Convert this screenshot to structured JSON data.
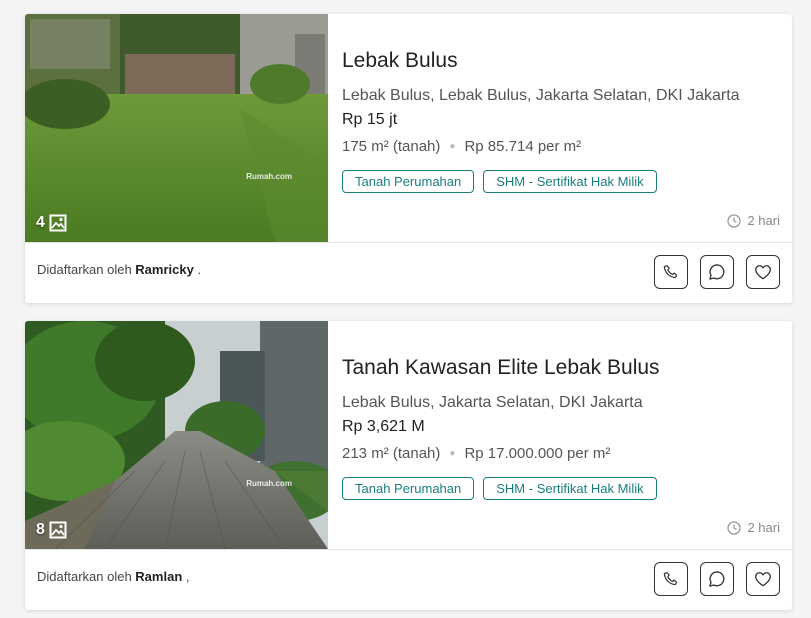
{
  "listings": [
    {
      "title": "Lebak Bulus",
      "address": "Lebak Bulus, Lebak Bulus, Jakarta Selatan, DKI Jakarta",
      "price": "Rp 15 jt",
      "area": "175 m² (tanah)",
      "price_per_m2": "Rp 85.714 per m²",
      "tags": [
        "Tanah Perumahan",
        "SHM - Sertifikat Hak Milik"
      ],
      "photo_count": "4",
      "photo_icon": "image-icon",
      "watermark": "Rumah.com",
      "time_ago": "2 hari",
      "listed_by_label": "Didaftarkan oleh",
      "agent": "Ramricky",
      "agent_suffix": ".",
      "actions": [
        "phone-icon",
        "chat-icon",
        "heart-icon"
      ]
    },
    {
      "title": "Tanah Kawasan Elite Lebak Bulus",
      "address": "Lebak Bulus, Jakarta Selatan, DKI Jakarta",
      "price": "Rp 3,621 M",
      "area": "213 m² (tanah)",
      "price_per_m2": "Rp 17.000.000 per m²",
      "tags": [
        "Tanah Perumahan",
        "SHM - Sertifikat Hak Milik"
      ],
      "photo_count": "8",
      "photo_icon": "image-icon",
      "watermark": "Rumah.com",
      "time_ago": "2 hari",
      "listed_by_label": "Didaftarkan oleh",
      "agent": "Ramlan",
      "agent_suffix": ",",
      "actions": [
        "phone-icon",
        "chat-icon",
        "heart-icon"
      ]
    }
  ],
  "colors": {
    "accent": "#1a7f7c",
    "page_bg": "#f4f4f4",
    "card_bg": "#ffffff"
  }
}
